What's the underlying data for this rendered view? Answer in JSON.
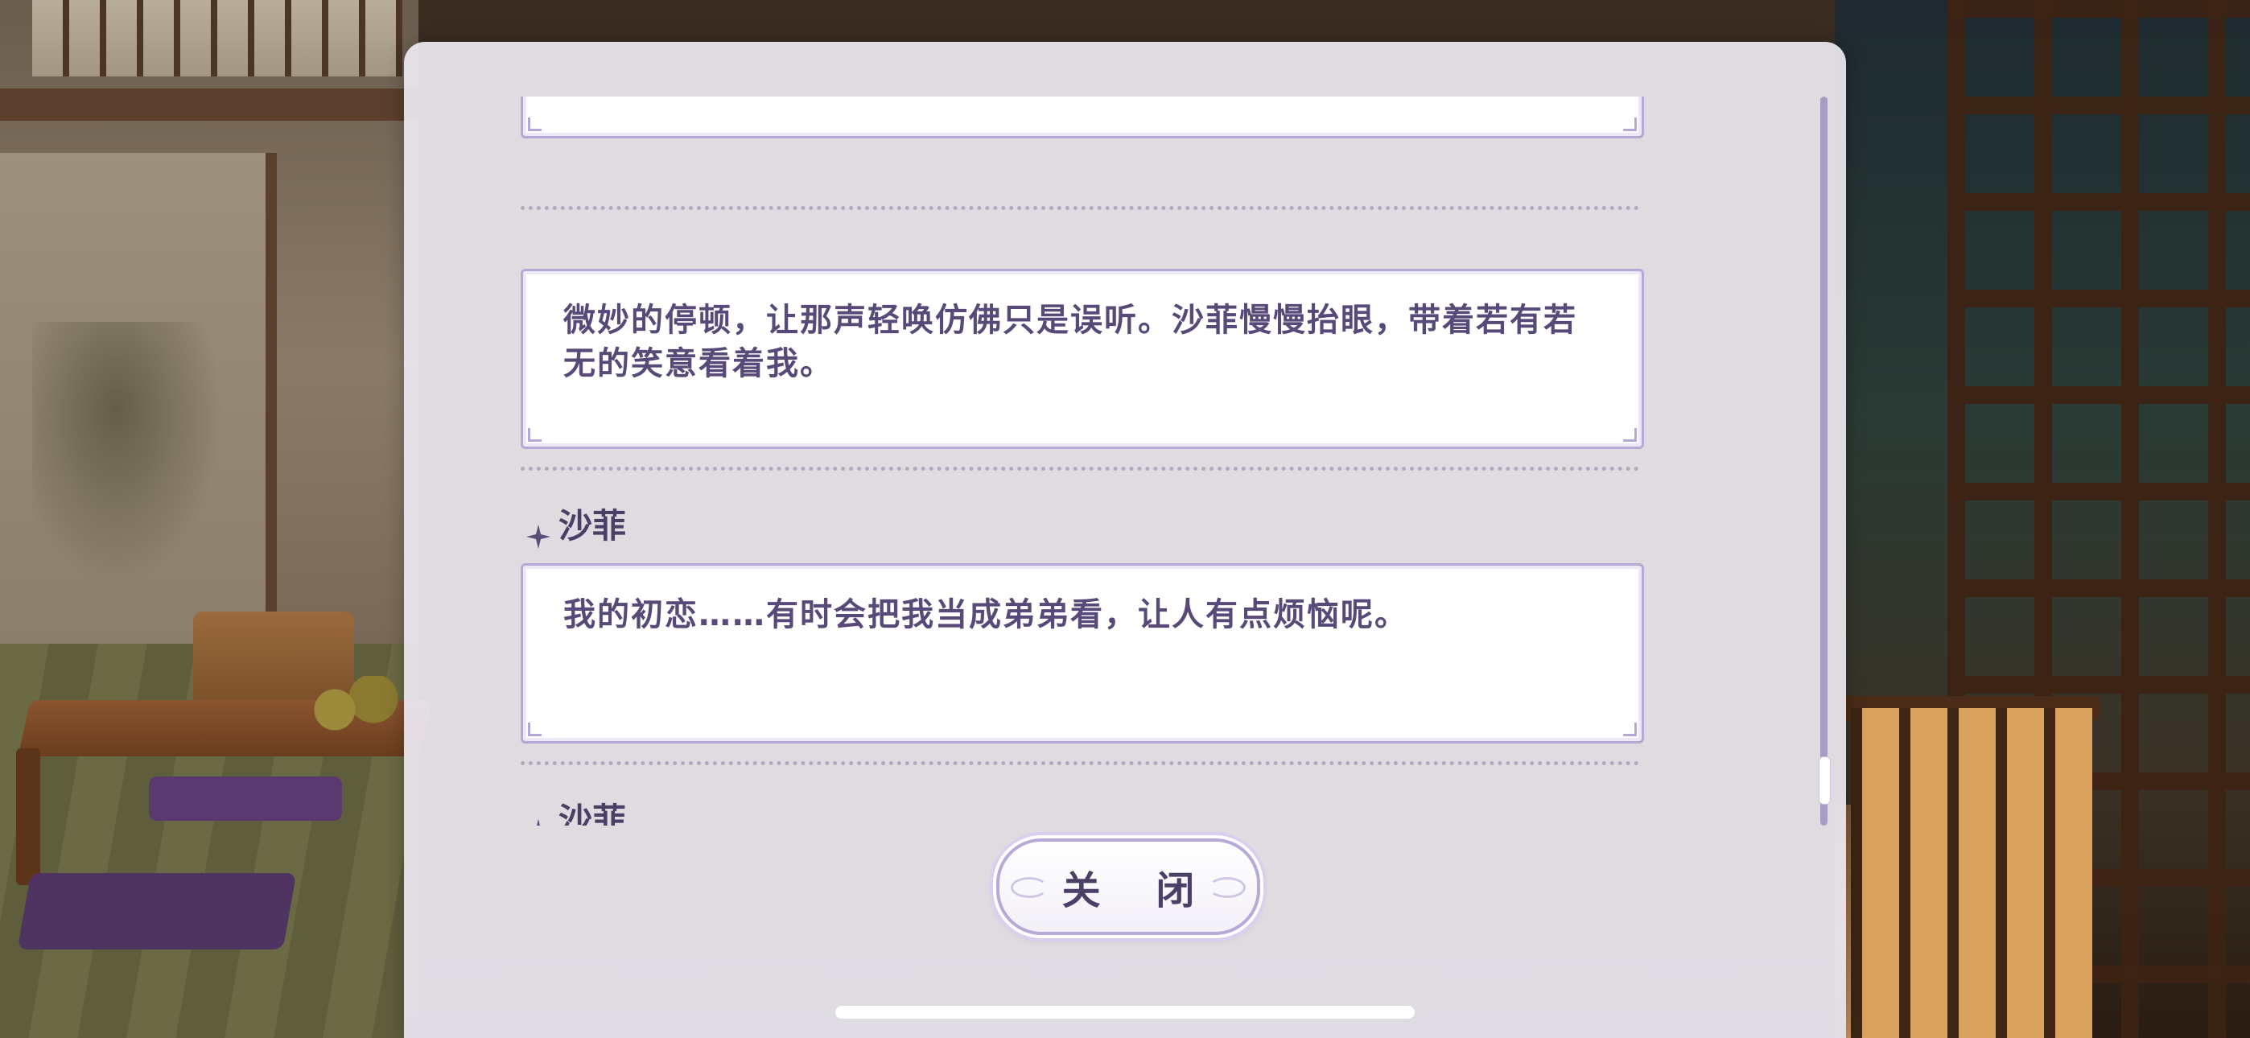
{
  "dialog": {
    "entries": [
      {
        "type": "narration",
        "text": ""
      },
      {
        "type": "narration",
        "text": "微妙的停顿，让那声轻唤仿佛只是误听。沙菲慢慢抬眼，带着若有若无的笑意看着我。"
      },
      {
        "type": "line",
        "speaker": "沙菲",
        "text": "我的初恋……有时会把我当成弟弟看，让人有点烦恼呢。"
      },
      {
        "type": "line",
        "speaker": "沙菲",
        "text": ""
      }
    ],
    "close_label": "关 闭"
  },
  "colors": {
    "accent": "#b4a8d6",
    "text": "#574a78",
    "panel": "#ece8f0"
  },
  "icons": {
    "speaker_marker": "sparkle-icon"
  }
}
